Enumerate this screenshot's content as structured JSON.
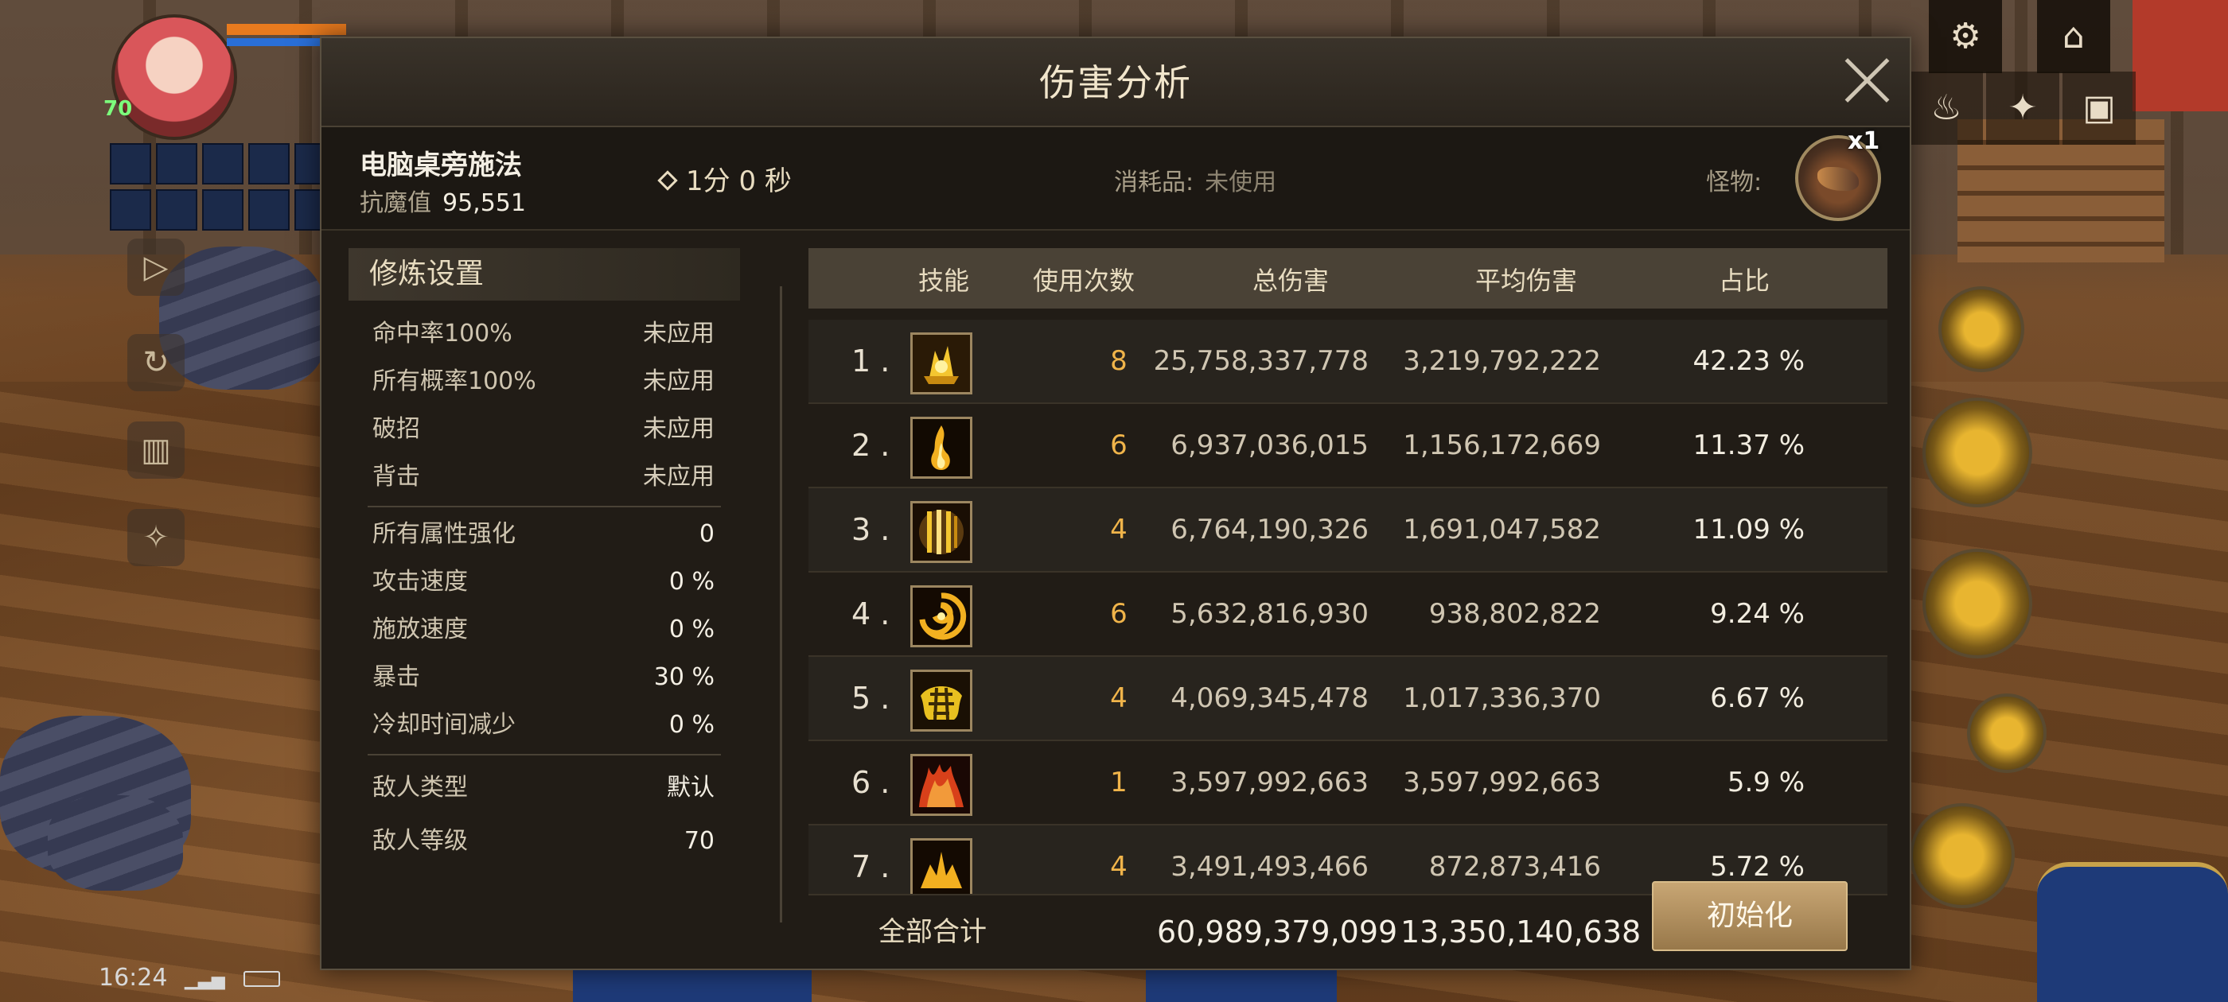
{
  "dialog": {
    "title": "伤害分析",
    "close_label": "×"
  },
  "info": {
    "character_name": "电脑桌旁施法",
    "resist_label": "抗魔值",
    "resist_value": "95,551",
    "duration": "1分 0 秒",
    "consumable_label": "消耗品:",
    "consumable_value": "未使用",
    "monster_label": "怪物:",
    "monster_count": "x1"
  },
  "training": {
    "title": "修炼设置",
    "group1": [
      {
        "label": "命中率100%",
        "value": "未应用"
      },
      {
        "label": "所有概率100%",
        "value": "未应用"
      },
      {
        "label": "破招",
        "value": "未应用"
      },
      {
        "label": "背击",
        "value": "未应用"
      }
    ],
    "group2": [
      {
        "label": "所有属性强化",
        "value": "0"
      },
      {
        "label": "攻击速度",
        "value": "0 %"
      },
      {
        "label": "施放速度",
        "value": "0 %"
      },
      {
        "label": "暴击",
        "value": "30 %"
      },
      {
        "label": "冷却时间减少",
        "value": "0 %"
      }
    ],
    "group3": [
      {
        "label": "敌人类型",
        "value": "默认"
      },
      {
        "label": "敌人等级",
        "value": "70"
      }
    ]
  },
  "table": {
    "headers": {
      "skill": "技能",
      "uses": "使用次数",
      "total": "总伤害",
      "avg": "平均伤害",
      "ratio": "占比"
    },
    "rows": [
      {
        "rank": "1 .",
        "icon": "golden-crystal-burst-icon",
        "uses": "8",
        "total": "25,758,337,778",
        "avg": "3,219,792,222",
        "ratio": "42.23 %"
      },
      {
        "rank": "2 .",
        "icon": "flame-pillar-icon",
        "uses": "6",
        "total": "6,937,036,015",
        "avg": "1,156,172,669",
        "ratio": "11.37 %"
      },
      {
        "rank": "3 .",
        "icon": "light-bars-icon",
        "uses": "4",
        "total": "6,764,190,326",
        "avg": "1,691,047,582",
        "ratio": "11.09 %"
      },
      {
        "rank": "4 .",
        "icon": "vortex-icon",
        "uses": "6",
        "total": "5,632,816,930",
        "avg": "938,802,822",
        "ratio": "9.24 %"
      },
      {
        "rank": "5 .",
        "icon": "golden-web-icon",
        "uses": "4",
        "total": "4,069,345,478",
        "avg": "1,017,336,370",
        "ratio": "6.67 %"
      },
      {
        "rank": "6 .",
        "icon": "red-fire-wave-icon",
        "uses": "1",
        "total": "3,597,992,663",
        "avg": "3,597,992,663",
        "ratio": "5.9 %"
      },
      {
        "rank": "7 .",
        "icon": "golden-eruption-icon",
        "uses": "4",
        "total": "3,491,493,466",
        "avg": "872,873,416",
        "ratio": "5.72 %"
      }
    ],
    "footer": {
      "label": "全部合计",
      "total": "60,989,379,099",
      "avg": "13,350,140,638"
    },
    "reset_label": "初始化"
  },
  "hud": {
    "level": "70",
    "clock": "16:24"
  },
  "colors": {
    "accent": "#f0b44a",
    "panel": "#211c16",
    "button": "#c8a674"
  }
}
